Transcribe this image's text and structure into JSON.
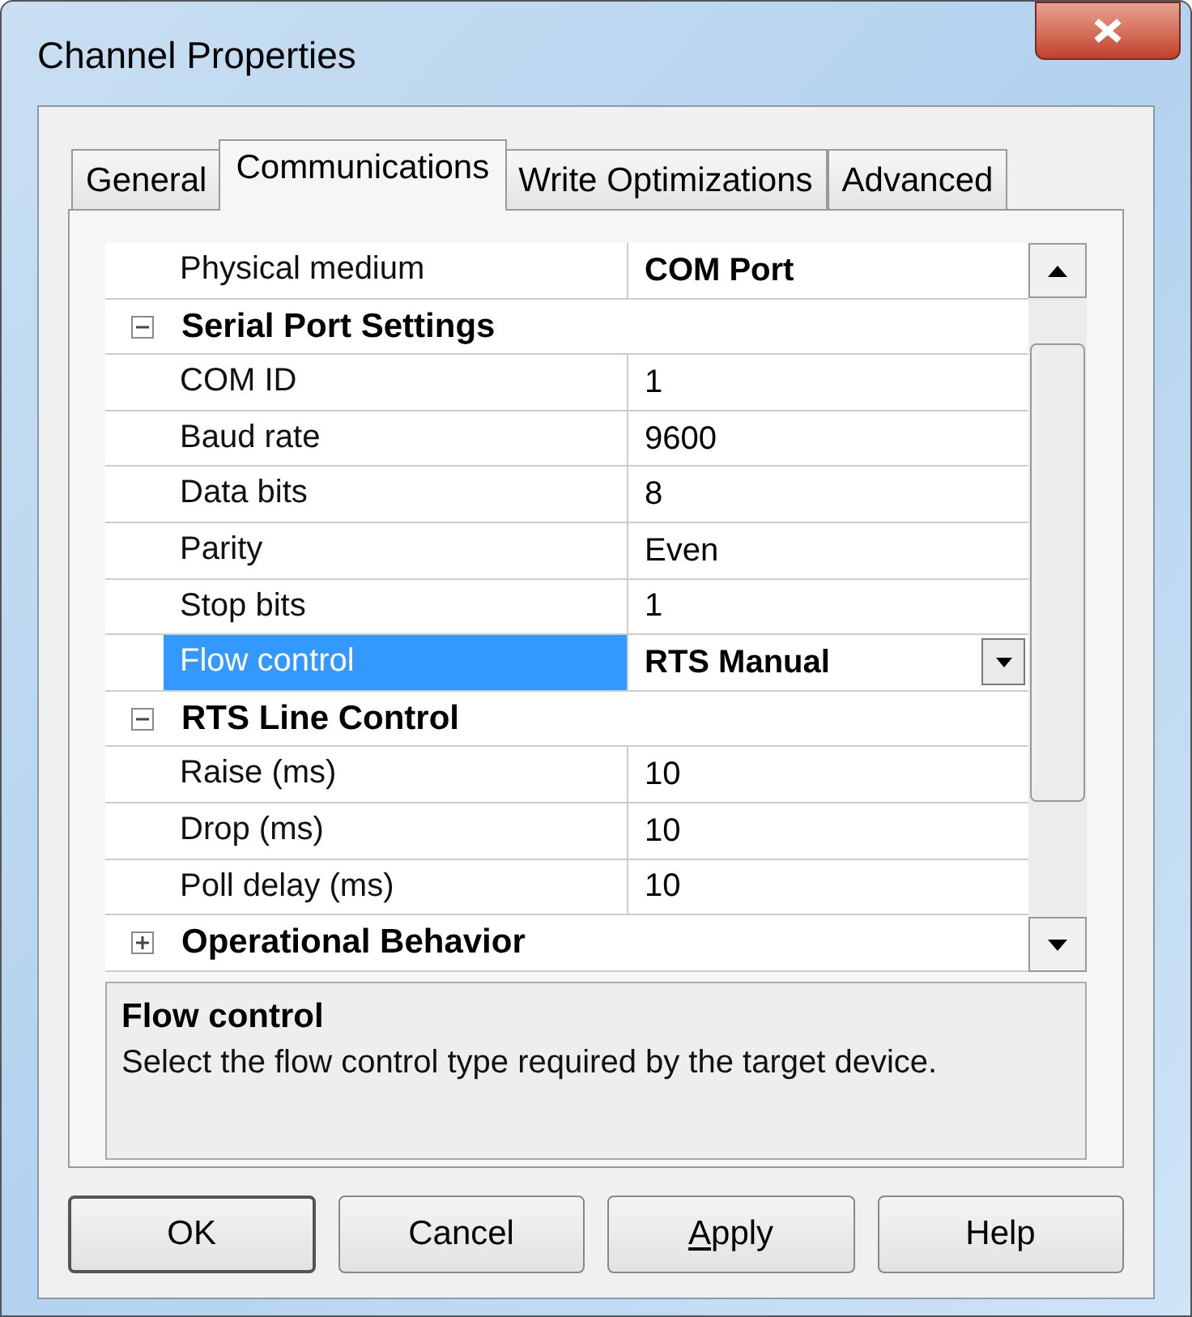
{
  "window": {
    "title": "Channel Properties"
  },
  "tabs": [
    {
      "label": "General",
      "selected": false
    },
    {
      "label": "Communications",
      "selected": true
    },
    {
      "label": "Write Optimizations",
      "selected": false
    },
    {
      "label": "Advanced",
      "selected": false
    }
  ],
  "properties": [
    {
      "kind": "item",
      "label": "Physical medium",
      "value": "COM Port",
      "bold": true,
      "selected": false,
      "dropdown": false
    },
    {
      "kind": "group",
      "label": "Serial Port Settings",
      "expanded": true
    },
    {
      "kind": "item",
      "label": "COM ID",
      "value": "1",
      "bold": false,
      "selected": false,
      "dropdown": false
    },
    {
      "kind": "item",
      "label": "Baud rate",
      "value": "9600",
      "bold": false,
      "selected": false,
      "dropdown": false
    },
    {
      "kind": "item",
      "label": "Data bits",
      "value": "8",
      "bold": false,
      "selected": false,
      "dropdown": false
    },
    {
      "kind": "item",
      "label": "Parity",
      "value": "Even",
      "bold": false,
      "selected": false,
      "dropdown": false
    },
    {
      "kind": "item",
      "label": "Stop bits",
      "value": "1",
      "bold": false,
      "selected": false,
      "dropdown": false
    },
    {
      "kind": "item",
      "label": "Flow control",
      "value": "RTS Manual",
      "bold": true,
      "selected": true,
      "dropdown": true
    },
    {
      "kind": "group",
      "label": "RTS Line Control",
      "expanded": true
    },
    {
      "kind": "item",
      "label": "Raise (ms)",
      "value": "10",
      "bold": false,
      "selected": false,
      "dropdown": false
    },
    {
      "kind": "item",
      "label": "Drop (ms)",
      "value": "10",
      "bold": false,
      "selected": false,
      "dropdown": false
    },
    {
      "kind": "item",
      "label": "Poll delay (ms)",
      "value": "10",
      "bold": false,
      "selected": false,
      "dropdown": false
    },
    {
      "kind": "group",
      "label": "Operational Behavior",
      "expanded": false
    }
  ],
  "description": {
    "title": "Flow control",
    "text": "Select the flow control type required by the target device."
  },
  "buttons": [
    {
      "label": "OK",
      "default": true,
      "underline_first": false
    },
    {
      "label": "Cancel",
      "default": false,
      "underline_first": false
    },
    {
      "label": "Apply",
      "default": false,
      "underline_first": true
    },
    {
      "label": "Help",
      "default": false,
      "underline_first": false
    }
  ]
}
